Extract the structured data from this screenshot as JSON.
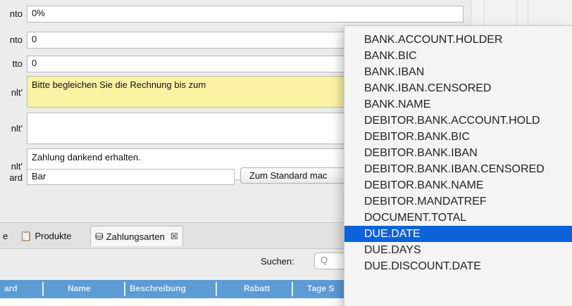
{
  "form": {
    "rows": [
      {
        "label": "nto",
        "value": "0%"
      },
      {
        "label": "nto",
        "value": "0"
      },
      {
        "label": "tto",
        "value": "0"
      },
      {
        "label": "nlt'",
        "value": "Bitte begleichen Sie die Rechnung bis zum"
      },
      {
        "label": "nlt'",
        "value": ""
      },
      {
        "label": "nlt'",
        "value": "Zahlung dankend erhalten."
      },
      {
        "label": "ard",
        "value": "Bar"
      }
    ],
    "default_button": "Zum Standard mac",
    "field_colors": {
      "highlight": "#fbf3a4",
      "normal": "#ffffff"
    }
  },
  "tabs": [
    {
      "label": "e",
      "icon": "",
      "selected": false
    },
    {
      "label": "Produkte",
      "icon": "clipboard-icon",
      "selected": false
    },
    {
      "label": "Zahlungsarten",
      "icon": "coins-icon",
      "selected": true,
      "close": "☒"
    }
  ],
  "search": {
    "label": "Suchen:",
    "placeholder": "Q"
  },
  "table": {
    "header_color": "#5c9bd3",
    "columns": [
      "ard",
      "Name",
      "Beschreibung",
      "Rabatt",
      "Tage S"
    ]
  },
  "dropdown": {
    "selected_color": "#0c62d8",
    "items": [
      "BANK.ACCOUNT.HOLDER",
      "BANK.BIC",
      "BANK.IBAN",
      "BANK.IBAN.CENSORED",
      "BANK.NAME",
      "DEBITOR.BANK.ACCOUNT.HOLD",
      "DEBITOR.BANK.BIC",
      "DEBITOR.BANK.IBAN",
      "DEBITOR.BANK.IBAN.CENSORED",
      "DEBITOR.BANK.NAME",
      "DEBITOR.MANDATREF",
      "DOCUMENT.TOTAL",
      "DUE.DATE",
      "DUE.DAYS",
      "DUE.DISCOUNT.DATE"
    ],
    "selected_index": 12
  }
}
